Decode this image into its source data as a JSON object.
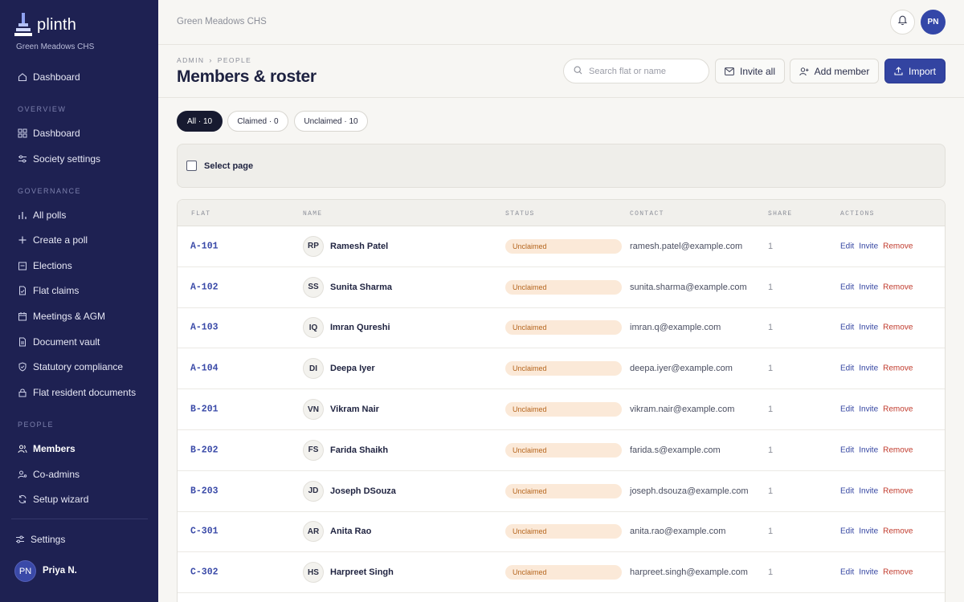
{
  "brand": {
    "name": "plinth",
    "society": "Green Meadows CHS"
  },
  "sidebar": {
    "top_item": {
      "label": "Dashboard",
      "icon": "home-icon"
    },
    "sections": {
      "overview": "OVERVIEW",
      "governance": "GOVERNANCE",
      "people": "PEOPLE"
    },
    "overview_items": [
      {
        "label": "Dashboard",
        "icon": "grid-icon"
      },
      {
        "label": "Society settings",
        "icon": "sliders-icon"
      }
    ],
    "governance_items": [
      {
        "label": "All polls",
        "icon": "bar-chart-icon"
      },
      {
        "label": "Create a poll",
        "icon": "plus-icon"
      },
      {
        "label": "Elections",
        "icon": "ballot-icon"
      },
      {
        "label": "Flat claims",
        "icon": "document-check-icon"
      },
      {
        "label": "Meetings & AGM",
        "icon": "calendar-icon"
      },
      {
        "label": "Document vault",
        "icon": "file-icon"
      },
      {
        "label": "Statutory compliance",
        "icon": "shield-icon"
      },
      {
        "label": "Flat resident documents",
        "icon": "lock-icon"
      }
    ],
    "people_items": [
      {
        "label": "Members",
        "icon": "users-icon",
        "active": true
      },
      {
        "label": "Co-admins",
        "icon": "user-key-icon"
      },
      {
        "label": "Setup wizard",
        "icon": "refresh-icon"
      }
    ],
    "settings": {
      "label": "Settings",
      "icon": "settings-icon"
    },
    "user": {
      "initials": "PN",
      "name": "Priya N."
    }
  },
  "topbar": {
    "society": "Green Meadows CHS",
    "avatar_initials": "PN"
  },
  "header": {
    "breadcrumb": [
      "ADMIN",
      "PEOPLE"
    ],
    "breadcrumb_sep": "›",
    "title": "Members & roster",
    "search_placeholder": "Search flat or name",
    "invite_all": "Invite all",
    "add_member": "Add member",
    "import": "Import"
  },
  "filters": [
    {
      "label": "All · 10",
      "active": true
    },
    {
      "label": "Claimed · 0",
      "active": false
    },
    {
      "label": "Unclaimed · 10",
      "active": false
    }
  ],
  "select_page": "Select page",
  "table": {
    "columns": [
      "FLAT",
      "NAME",
      "STATUS",
      "CONTACT",
      "SHARE",
      "ACTIONS"
    ],
    "actions": {
      "edit": "Edit",
      "invite": "Invite",
      "remove": "Remove"
    },
    "rows": [
      {
        "flat": "A-101",
        "initials": "RP",
        "name": "Ramesh Patel",
        "status": "Unclaimed",
        "contact": "ramesh.patel@example.com",
        "share": "1"
      },
      {
        "flat": "A-102",
        "initials": "SS",
        "name": "Sunita Sharma",
        "status": "Unclaimed",
        "contact": "sunita.sharma@example.com",
        "share": "1"
      },
      {
        "flat": "A-103",
        "initials": "IQ",
        "name": "Imran Qureshi",
        "status": "Unclaimed",
        "contact": "imran.q@example.com",
        "share": "1"
      },
      {
        "flat": "A-104",
        "initials": "DI",
        "name": "Deepa Iyer",
        "status": "Unclaimed",
        "contact": "deepa.iyer@example.com",
        "share": "1"
      },
      {
        "flat": "B-201",
        "initials": "VN",
        "name": "Vikram Nair",
        "status": "Unclaimed",
        "contact": "vikram.nair@example.com",
        "share": "1"
      },
      {
        "flat": "B-202",
        "initials": "FS",
        "name": "Farida Shaikh",
        "status": "Unclaimed",
        "contact": "farida.s@example.com",
        "share": "1"
      },
      {
        "flat": "B-203",
        "initials": "JD",
        "name": "Joseph DSouza",
        "status": "Unclaimed",
        "contact": "joseph.dsouza@example.com",
        "share": "1"
      },
      {
        "flat": "C-301",
        "initials": "AR",
        "name": "Anita Rao",
        "status": "Unclaimed",
        "contact": "anita.rao@example.com",
        "share": "1"
      },
      {
        "flat": "C-302",
        "initials": "HS",
        "name": "Harpreet Singh",
        "status": "Unclaimed",
        "contact": "harpreet.singh@example.com",
        "share": "1"
      }
    ]
  }
}
